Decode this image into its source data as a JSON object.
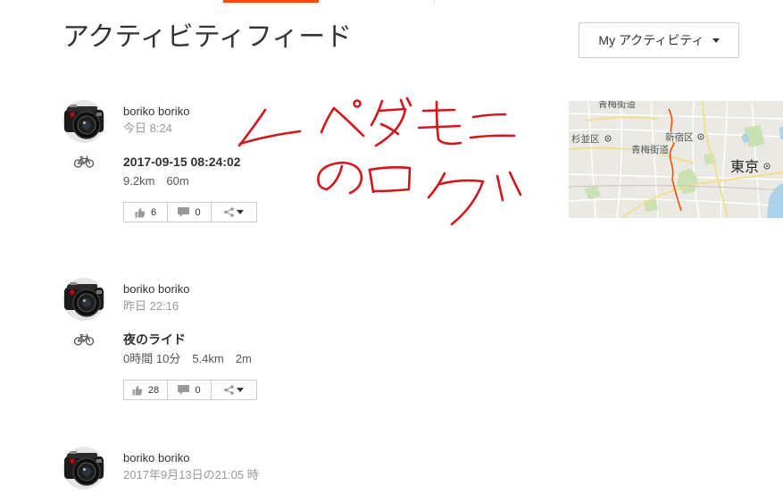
{
  "header": {
    "title": "アクティビティフィード",
    "filter_label": "My アクティビティ"
  },
  "activities": [
    {
      "athlete": "boriko boriko",
      "time": "今日 8:24",
      "title": "2017-09-15 08:24:02",
      "stats": [
        "9.2km",
        "60m"
      ],
      "kudos": "6",
      "comments": "0",
      "sport_icon": "bicycle-icon"
    },
    {
      "athlete": "boriko boriko",
      "time": "昨日 22:16",
      "title": "夜のライド",
      "stats": [
        "0時間 10分",
        "5.4km",
        "2m"
      ],
      "kudos": "28",
      "comments": "0",
      "sport_icon": "bicycle-icon"
    },
    {
      "athlete": "boriko boriko",
      "time": "2017年9月13日の21:05 時"
    }
  ],
  "map": {
    "labels": {
      "road_top": "青梅街道",
      "suginami": "杉並区",
      "road": "青梅街道",
      "shinjuku": "新宿区",
      "tokyo": "東京"
    }
  },
  "annotation": {
    "text": "ペダモニのログ"
  },
  "icons": {
    "kudos": "thumbs-up-icon",
    "comment": "comment-icon",
    "share": "share-icon",
    "dropdown": "caret-down-icon",
    "avatar": "camera-avatar"
  },
  "colors": {
    "accent": "#fc4c02",
    "annotation": "#d4161c",
    "muted_text": "#999999"
  }
}
